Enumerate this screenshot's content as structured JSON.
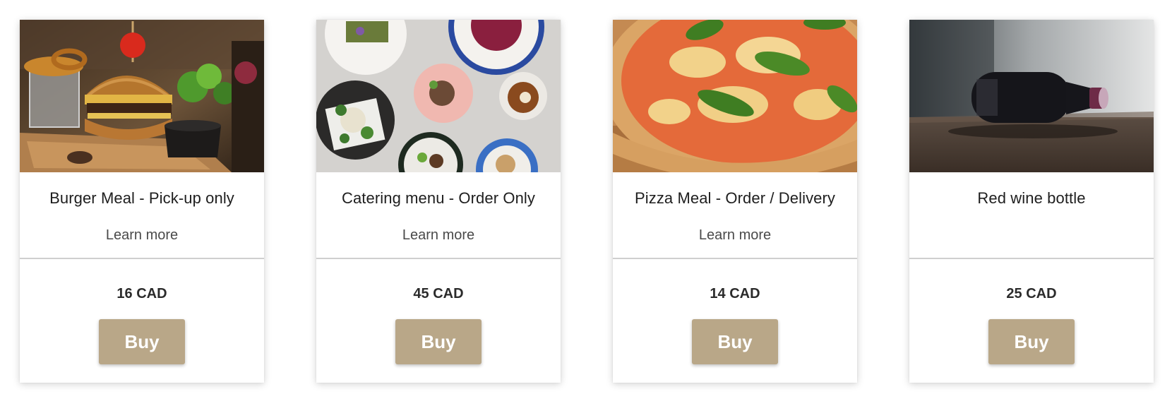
{
  "products": [
    {
      "title": "Burger Meal - Pick-up only",
      "link": "Learn more",
      "price": "16 CAD",
      "button": "Buy",
      "image": "burger-meal-photo"
    },
    {
      "title": "Catering menu - Order Only",
      "link": "Learn more",
      "price": "45 CAD",
      "button": "Buy",
      "image": "catering-dishes-photo"
    },
    {
      "title": "Pizza Meal - Order / Delivery",
      "link": "Learn more",
      "price": "14 CAD",
      "button": "Buy",
      "image": "pizza-photo"
    },
    {
      "title": "Red wine bottle",
      "price": "25 CAD",
      "button": "Buy",
      "image": "red-wine-bottle-photo"
    }
  ],
  "colors": {
    "button": "#b9a788",
    "divider": "#cfcfcf"
  }
}
